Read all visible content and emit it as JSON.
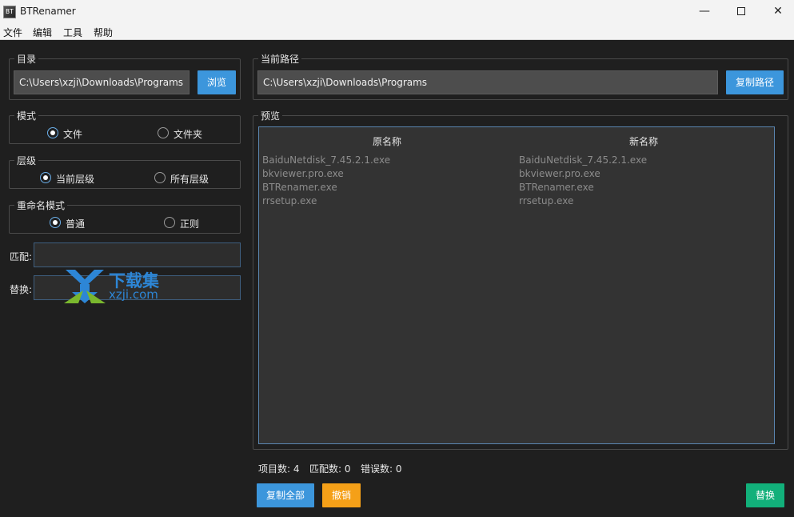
{
  "window": {
    "title": "BTRenamer",
    "icon_text": "BT",
    "min_glyph": "—",
    "close_glyph": "✕"
  },
  "menu": [
    "文件",
    "编辑",
    "工具",
    "帮助"
  ],
  "directory": {
    "label": "目录",
    "path": "C:\\Users\\xzji\\Downloads\\Programs",
    "browse_label": "浏览"
  },
  "mode": {
    "label": "模式",
    "options": [
      "文件",
      "文件夹"
    ],
    "selected": 0
  },
  "level": {
    "label": "层级",
    "options": [
      "当前层级",
      "所有层级"
    ],
    "selected": 0
  },
  "rename_mode": {
    "label": "重命名模式",
    "options": [
      "普通",
      "正则"
    ],
    "selected": 0
  },
  "match": {
    "label": "匹配:",
    "value": ""
  },
  "replace": {
    "label": "替换:",
    "value": ""
  },
  "current_path": {
    "label": "当前路径",
    "path": "C:\\Users\\xzji\\Downloads\\Programs",
    "copy_label": "复制路径"
  },
  "preview": {
    "label": "预览",
    "col_original": "原名称",
    "col_new": "新名称",
    "rows": [
      {
        "original": "BaiduNetdisk_7.45.2.1.exe",
        "new": "BaiduNetdisk_7.45.2.1.exe"
      },
      {
        "original": "bkviewer.pro.exe",
        "new": "bkviewer.pro.exe"
      },
      {
        "original": "BTRenamer.exe",
        "new": "BTRenamer.exe"
      },
      {
        "original": "rrsetup.exe",
        "new": "rrsetup.exe"
      }
    ]
  },
  "status": {
    "items": "项目数: 4",
    "matches": "匹配数: 0",
    "errors": "错误数: 0"
  },
  "actions": {
    "copy_all": "复制全部",
    "undo": "撤销",
    "replace": "替换"
  },
  "watermark": {
    "cn": "下载集",
    "url": "xzji.com"
  },
  "colors": {
    "accent_blue": "#3c96dc",
    "undo_orange": "#f5a018",
    "replace_green": "#12b07a",
    "background": "#1f1f1f"
  }
}
